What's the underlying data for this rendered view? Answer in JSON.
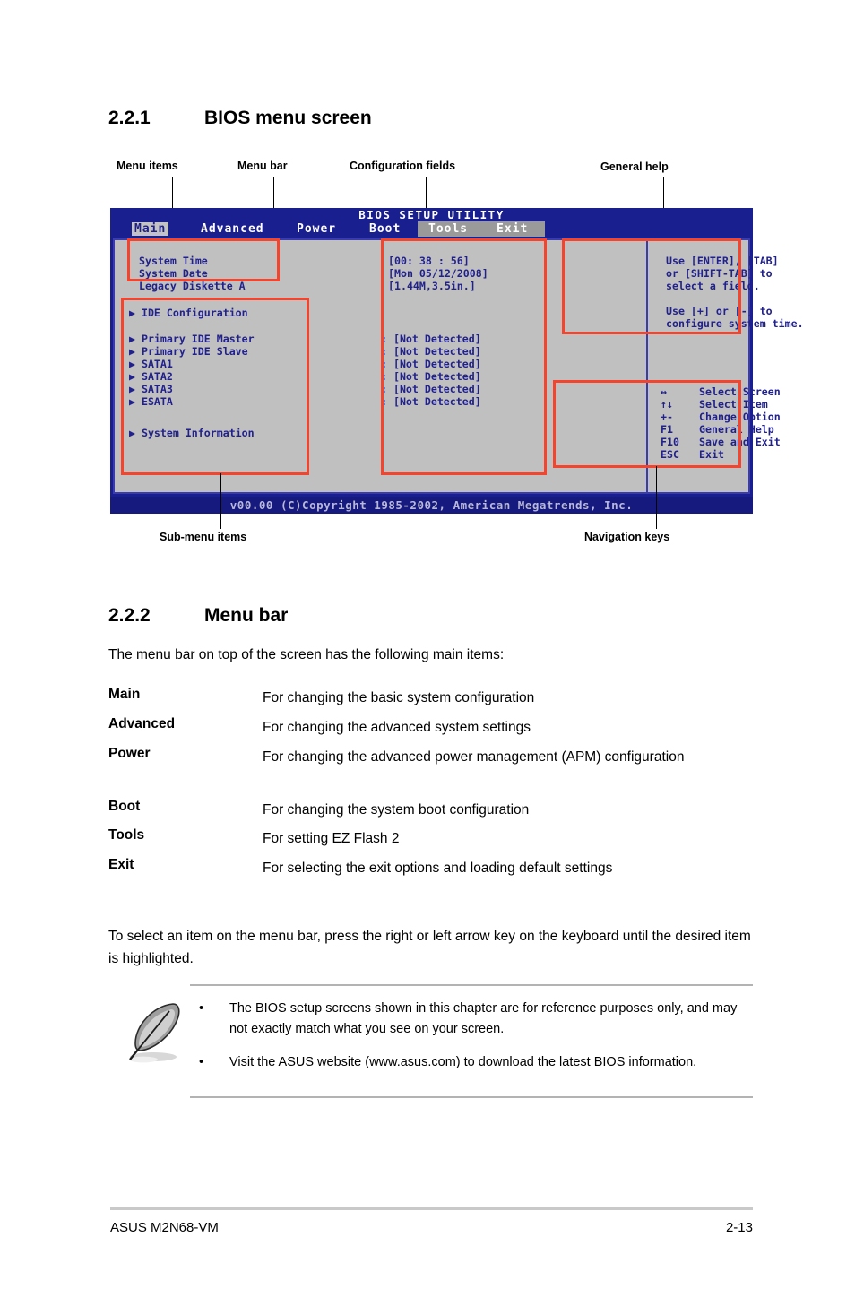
{
  "sections": {
    "s1": {
      "number": "2.2.1",
      "title": "BIOS menu screen"
    },
    "s2": {
      "number": "2.2.2",
      "title": "Menu bar"
    }
  },
  "callouts": {
    "menu_items": "Menu items",
    "menu_bar": "Menu bar",
    "configuration_fields": "Configuration fields",
    "general_help": "General help",
    "sub_menu_items": "Sub-menu items",
    "navigation_keys": "Navigation keys"
  },
  "bios": {
    "title": "BIOS SETUP UTILITY",
    "menubar": [
      {
        "label": "Main",
        "active": true
      },
      {
        "label": "Advanced",
        "active": false
      },
      {
        "label": "Power",
        "active": false
      },
      {
        "label": "Boot",
        "active": false
      },
      {
        "label": "Tools",
        "active": false
      },
      {
        "label": "Exit",
        "active": false
      }
    ],
    "menu_items": [
      "System Time",
      "System Date",
      "Legacy Diskette A"
    ],
    "config_values": [
      "[00: 38 : 56]",
      "[Mon 05/12/2008]",
      "[1.44M,3.5in.]"
    ],
    "submenu_items": [
      "IDE Configuration",
      "Primary IDE Master",
      "Primary IDE Slave",
      "SATA1",
      "SATA2",
      "SATA3",
      "ESATA",
      "System Information"
    ],
    "device_status": [
      ": [Not Detected]",
      ": [Not Detected]",
      ": [Not Detected]",
      ": [Not Detected]",
      ": [Not Detected]",
      ": [Not Detected]"
    ],
    "general_help": [
      "Use [ENTER], [TAB]",
      "or [SHIFT-TAB] to",
      "select a field.",
      "",
      "Use [+] or [-] to",
      "configure system time."
    ],
    "nav_keys": [
      {
        "key": "↔",
        "action": "Select Screen"
      },
      {
        "key": "↑↓",
        "action": "Select Item"
      },
      {
        "key": "+-",
        "action": "Change Option"
      },
      {
        "key": "F1",
        "action": "General Help"
      },
      {
        "key": "F10",
        "action": "Save and Exit"
      },
      {
        "key": "ESC",
        "action": "Exit"
      }
    ],
    "copyright": "v00.00 (C)Copyright 1985-2002, American Megatrends, Inc.",
    "colors": {
      "chrome_blue": "#1a1f8f",
      "panel_gray": "#c0c0c0",
      "text_blue": "#21218d",
      "highlight_gray": "#c3c3c3",
      "annotation_red": "#f4442e"
    }
  },
  "menubar_section": {
    "intro": "The menu bar on top of the screen has the following main items:",
    "entries": [
      {
        "term": "Main",
        "desc": "For changing the basic system configuration"
      },
      {
        "term": "Advanced",
        "desc": "For changing the advanced system settings"
      },
      {
        "term": "Power",
        "desc": "For changing the advanced power management (APM) configuration"
      },
      {
        "term": "Boot",
        "desc": "For changing the system boot configuration"
      },
      {
        "term": "Tools",
        "desc": "For setting EZ Flash 2"
      },
      {
        "term": "Exit",
        "desc": "For selecting the exit options and loading default settings"
      }
    ],
    "outro": "To select an item on the menu bar, press the right or left arrow key on the keyboard until the desired item is highlighted."
  },
  "note": {
    "icon": "note-feather-icon",
    "bullet": "•",
    "items": [
      "The BIOS setup screens shown in this chapter are for reference purposes only, and may not exactly match what you see on your screen.",
      "Visit the ASUS website (www.asus.com) to download the latest BIOS information."
    ]
  },
  "footer": {
    "product": "ASUS M2N68-VM",
    "page": "2-13"
  }
}
